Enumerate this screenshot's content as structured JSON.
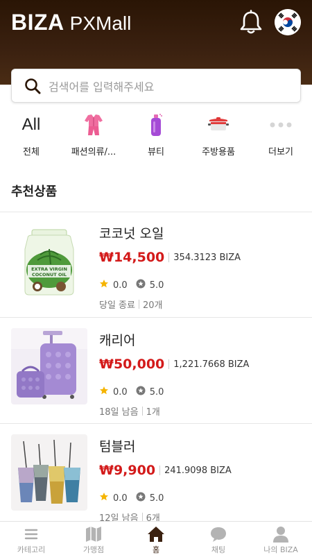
{
  "header": {
    "brand_bold": "BIZA",
    "brand_light": "PXMall",
    "bg_color": "#3b2110"
  },
  "search": {
    "placeholder": "검색어를 입력해주세요"
  },
  "categories": [
    {
      "label": "전체",
      "icon": "All"
    },
    {
      "label": "패션의류/...",
      "icon": "pink-outfit-icon"
    },
    {
      "label": "뷰티",
      "icon": "perfume-bottle-icon"
    },
    {
      "label": "주방용품",
      "icon": "cooking-pot-icon"
    },
    {
      "label": "더보기",
      "icon": "more-dots-icon"
    }
  ],
  "section": {
    "title": "추천상품"
  },
  "products": [
    {
      "name": "코코넛 오일",
      "price": "₩14,500",
      "biza": "354.3123 BIZA",
      "rating": "0.0",
      "score": "5.0",
      "status": "당일 종료",
      "count": "20개"
    },
    {
      "name": "캐리어",
      "price": "₩50,000",
      "biza": "1,221.7668 BIZA",
      "rating": "0.0",
      "score": "5.0",
      "status": "18일 남음",
      "count": "1개"
    },
    {
      "name": "텀블러",
      "price": "₩9,900",
      "biza": "241.9098 BIZA",
      "rating": "0.0",
      "score": "5.0",
      "status": "12일 남음",
      "count": "6개"
    }
  ],
  "tabs": [
    {
      "label": "카테고리",
      "icon": "menu-icon"
    },
    {
      "label": "가맹점",
      "icon": "map-icon"
    },
    {
      "label": "홈",
      "icon": "home-icon",
      "active": true
    },
    {
      "label": "채팅",
      "icon": "chat-icon"
    },
    {
      "label": "나의 BIZA",
      "icon": "person-icon"
    }
  ],
  "colors": {
    "price": "#d31a1a",
    "star": "#f5b400",
    "active_tab": "#3b2110"
  }
}
